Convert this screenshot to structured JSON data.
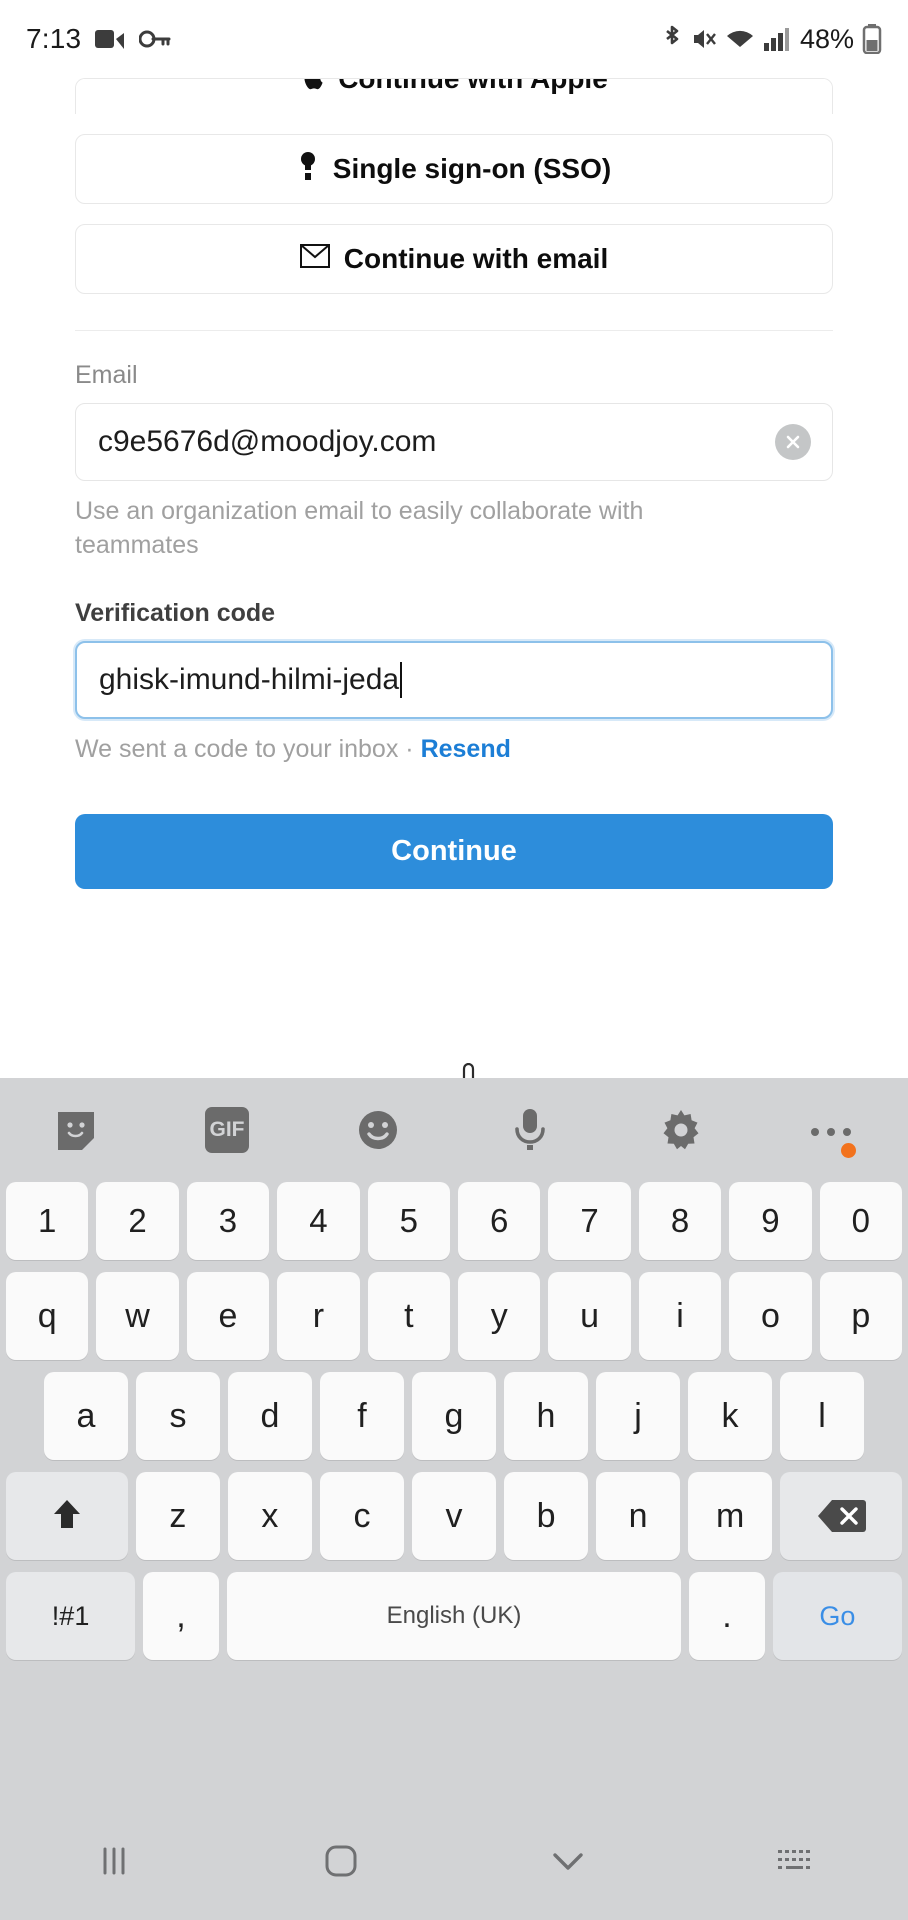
{
  "status_bar": {
    "time": "7:13",
    "left_icons": [
      "video-recording-icon",
      "vpn-key-icon"
    ],
    "right_icons": [
      "bluetooth-icon",
      "vibrate-mute-icon",
      "wifi-icon",
      "cellular-signal-icon"
    ],
    "battery_percent": "48%"
  },
  "auth": {
    "apple_button": "Continue with Apple",
    "sso_button": "Single sign-on (SSO)",
    "email_button": "Continue with email",
    "email_label": "Email",
    "email_value": "c9e5676d@moodjoy.com",
    "email_helper": "Use an organization email to easily collaborate with teammates",
    "code_label": "Verification code",
    "code_value": "ghisk-imund-hilmi-jeda",
    "code_helper": "We sent a code to your inbox · ",
    "resend_link": "Resend",
    "continue_button": "Continue",
    "accent_color": "#2d8ddb",
    "link_color": "#1c7ed6",
    "focus_border_color": "#8dc1ea"
  },
  "keyboard": {
    "toolbar": [
      "sticker-icon",
      "gif-icon",
      "emoji-icon",
      "microphone-icon",
      "settings-gear-icon",
      "more-options-icon"
    ],
    "gif_label": "GIF",
    "row_numbers": [
      "1",
      "2",
      "3",
      "4",
      "5",
      "6",
      "7",
      "8",
      "9",
      "0"
    ],
    "row_top": [
      "q",
      "w",
      "e",
      "r",
      "t",
      "y",
      "u",
      "i",
      "o",
      "p"
    ],
    "row_home": [
      "a",
      "s",
      "d",
      "f",
      "g",
      "h",
      "j",
      "k",
      "l"
    ],
    "row_bottom": [
      "z",
      "x",
      "c",
      "v",
      "b",
      "n",
      "m"
    ],
    "shift_key": "shift-icon",
    "backspace_key": "backspace-icon",
    "symbols_key": "!#1",
    "comma_key": ",",
    "space_key": "English (UK)",
    "period_key": ".",
    "enter_key": "Go"
  },
  "navigation_bar": {
    "recents": "recents-icon",
    "home": "home-icon",
    "back": "back-chevron-icon",
    "keyboard_switch": "keyboard-switch-icon"
  }
}
